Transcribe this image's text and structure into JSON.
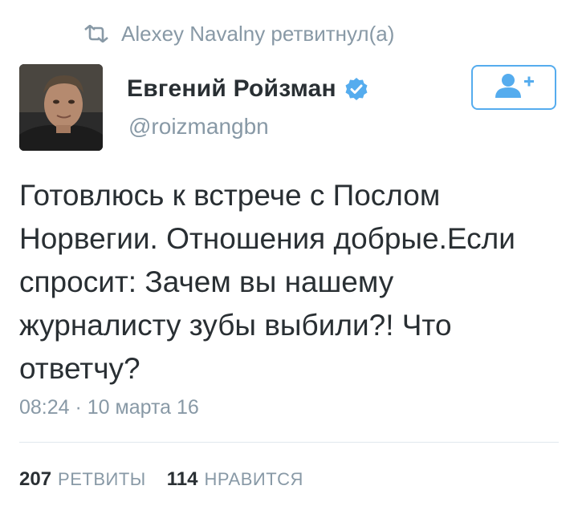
{
  "retweet": {
    "icon": "retweet-icon",
    "text": "Alexey Navalny ретвитнул(а)"
  },
  "author": {
    "display_name": "Евгений Ройзман",
    "handle": "@roizmangbn",
    "verified": true,
    "verified_icon": "verified-badge-icon",
    "avatar_icon": "avatar"
  },
  "follow_button": {
    "icon": "follow-user-plus-icon",
    "color": "#55acee"
  },
  "tweet": {
    "text": "Готовлюсь к встрече с Послом\nНорвегии. Отношения добрые.Если\nспросит: Зачем вы нашему\nжурналисту зубы выбили?! Что\nответчу?",
    "timestamp": "08:24 · 10 марта 16"
  },
  "stats": {
    "retweets_count": "207",
    "retweets_label": "РЕТВИТЫ",
    "likes_count": "114",
    "likes_label": "НРАВИТСЯ"
  },
  "colors": {
    "text": "#292f33",
    "muted": "#8899a6",
    "accent": "#55acee",
    "divider": "#e1e8ed"
  }
}
